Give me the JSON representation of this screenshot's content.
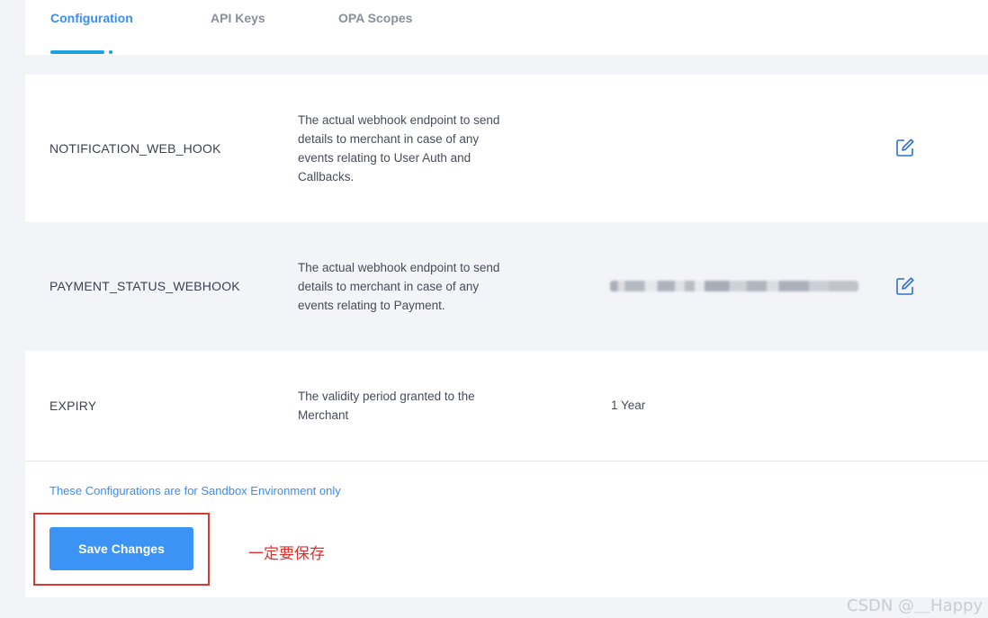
{
  "tabs": [
    {
      "label": "Configuration",
      "active": true
    },
    {
      "label": "API Keys",
      "active": false
    },
    {
      "label": "OPA Scopes",
      "active": false
    }
  ],
  "rows": [
    {
      "key": "NOTIFICATION_WEB_HOOK",
      "description": [
        "The actual webhook endpoint to send",
        "details to merchant in case of any",
        "events relating to User Auth and",
        "Callbacks."
      ],
      "value": "",
      "editable": true
    },
    {
      "key": "PAYMENT_STATUS_WEBHOOK",
      "description": [
        "The actual webhook endpoint to send",
        "details to merchant in case of any",
        "events relating to Payment."
      ],
      "value": "",
      "value_obscured": true,
      "editable": true
    },
    {
      "key": "EXPIRY",
      "description": [
        "The validity period granted to the",
        "Merchant"
      ],
      "value": "1 Year",
      "editable": false
    }
  ],
  "footer": {
    "note": "These Configurations are for Sandbox Environment only",
    "save_label": "Save Changes"
  },
  "annotation": {
    "text": "一定要保存",
    "color": "#e0302b"
  },
  "watermark": "CSDN @＿Happy",
  "colors": {
    "accent": "#3b8df0",
    "button": "#3b94f5",
    "tab_indicator": "#1aa3e0",
    "annotation_box": "#d63a35"
  },
  "icons": {
    "edit": "edit-pencil-square-icon"
  }
}
